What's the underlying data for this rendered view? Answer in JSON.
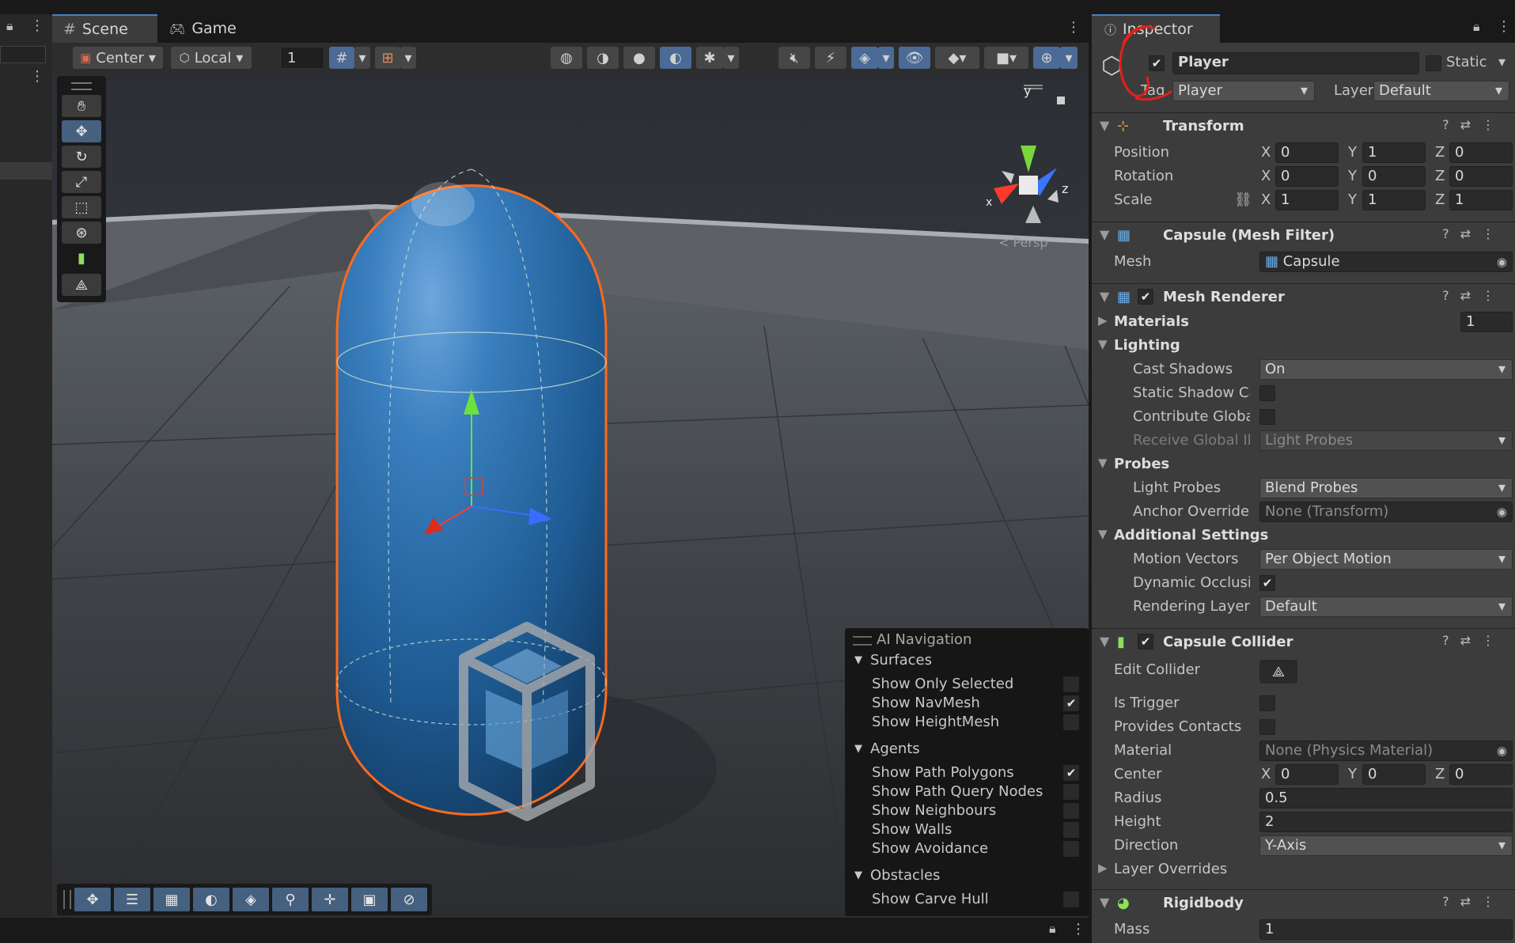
{
  "tabs": {
    "scene": "Scene",
    "game": "Game"
  },
  "toolbar": {
    "pivot_label": "Center",
    "space_label": "Local",
    "increment_value": "1",
    "persp_label": "Persp",
    "gizmo_axes": {
      "x": "x",
      "y": "y",
      "z": "z"
    }
  },
  "ai_nav": {
    "title": "AI Navigation",
    "surfaces": "Surfaces",
    "show_only_selected": "Show Only Selected",
    "show_navmesh": "Show NavMesh",
    "show_heightmesh": "Show HeightMesh",
    "agents": "Agents",
    "show_path_polygons": "Show Path Polygons",
    "show_path_query_nodes": "Show Path Query Nodes",
    "show_neighbours": "Show Neighbours",
    "show_walls": "Show Walls",
    "show_avoidance": "Show Avoidance",
    "obstacles": "Obstacles",
    "show_carve_hull": "Show Carve Hull",
    "checks": {
      "show_only_selected": false,
      "show_navmesh": true,
      "show_heightmesh": false,
      "show_path_polygons": true,
      "show_path_query_nodes": false,
      "show_neighbours": false,
      "show_walls": false,
      "show_avoidance": false,
      "show_carve_hull": false
    }
  },
  "inspector": {
    "tab_label": "Inspector",
    "object_name": "Player",
    "static_label": "Static",
    "tag_label": "Tag",
    "tag_value": "Player",
    "layer_label": "Layer",
    "layer_value": "Default",
    "transform": {
      "title": "Transform",
      "position_label": "Position",
      "rotation_label": "Rotation",
      "scale_label": "Scale",
      "position": {
        "x": "0",
        "y": "1",
        "z": "0"
      },
      "rotation": {
        "x": "0",
        "y": "0",
        "z": "0"
      },
      "scale": {
        "x": "1",
        "y": "1",
        "z": "1"
      }
    },
    "mesh_filter": {
      "title": "Capsule (Mesh Filter)",
      "mesh_label": "Mesh",
      "mesh_value": "Capsule"
    },
    "mesh_renderer": {
      "title": "Mesh Renderer",
      "materials_label": "Materials",
      "materials_count": "1",
      "lighting_label": "Lighting",
      "cast_shadows_label": "Cast Shadows",
      "cast_shadows_value": "On",
      "static_shadow_label": "Static Shadow Cas",
      "contribute_gi_label": "Contribute Global I",
      "receive_gi_label": "Receive Global Illu",
      "receive_gi_value": "Light Probes",
      "probes_label": "Probes",
      "light_probes_label": "Light Probes",
      "light_probes_value": "Blend Probes",
      "anchor_override_label": "Anchor Override",
      "anchor_override_value": "None (Transform)",
      "additional_settings_label": "Additional Settings",
      "motion_vectors_label": "Motion Vectors",
      "motion_vectors_value": "Per Object Motion",
      "dynamic_occlusion_label": "Dynamic Occlusior",
      "rendering_layer_label": "Rendering Layer M",
      "rendering_layer_value": "Default"
    },
    "capsule_collider": {
      "title": "Capsule Collider",
      "edit_collider_label": "Edit Collider",
      "is_trigger_label": "Is Trigger",
      "provides_contacts_label": "Provides Contacts",
      "material_label": "Material",
      "material_value": "None (Physics Material)",
      "center_label": "Center",
      "center": {
        "x": "0",
        "y": "0",
        "z": "0"
      },
      "radius_label": "Radius",
      "radius_value": "0.5",
      "height_label": "Height",
      "height_value": "2",
      "direction_label": "Direction",
      "direction_value": "Y-Axis",
      "layer_overrides_label": "Layer Overrides"
    },
    "rigidbody": {
      "title": "Rigidbody",
      "mass_label": "Mass",
      "mass_value": "1"
    }
  },
  "axis_letters": {
    "x": "X",
    "y": "Y",
    "z": "Z"
  }
}
